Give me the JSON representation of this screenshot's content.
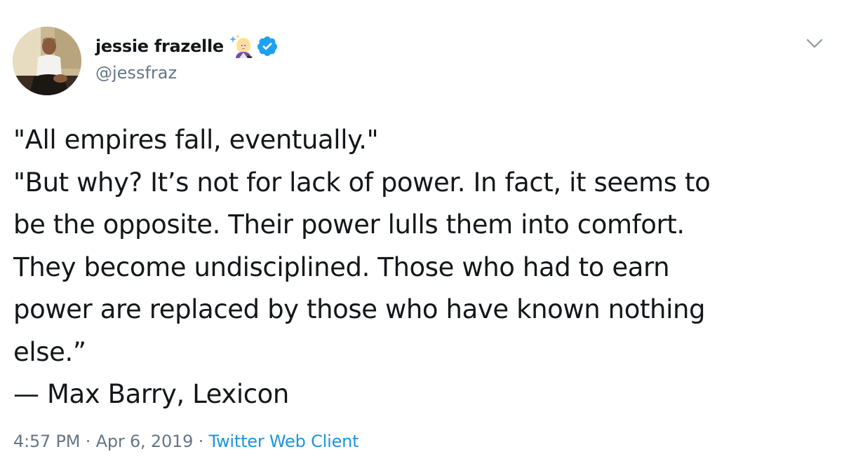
{
  "author": {
    "display_name": "jessie frazelle",
    "handle": "@jessfraz",
    "emoji_icon": "woman-mage-sparkles-icon",
    "verified_icon": "verified-badge-icon",
    "verified_color": "#1da1f2"
  },
  "tweet": {
    "lines": [
      "\"All empires fall, eventually.\"",
      "\"But why? It’s not for lack of power. In fact, it seems to",
      "be the opposite. Their power lulls them into comfort.",
      "They become undisciplined. Those who had to earn",
      "power are replaced by those who have known nothing",
      "else.”",
      "— Max Barry, Lexicon"
    ]
  },
  "meta": {
    "time": "4:57 PM",
    "separator": " · ",
    "date": "Apr 6, 2019",
    "source": "Twitter Web Client",
    "link_color": "#1b95e0"
  },
  "menu": {
    "icon": "chevron-down-icon"
  }
}
